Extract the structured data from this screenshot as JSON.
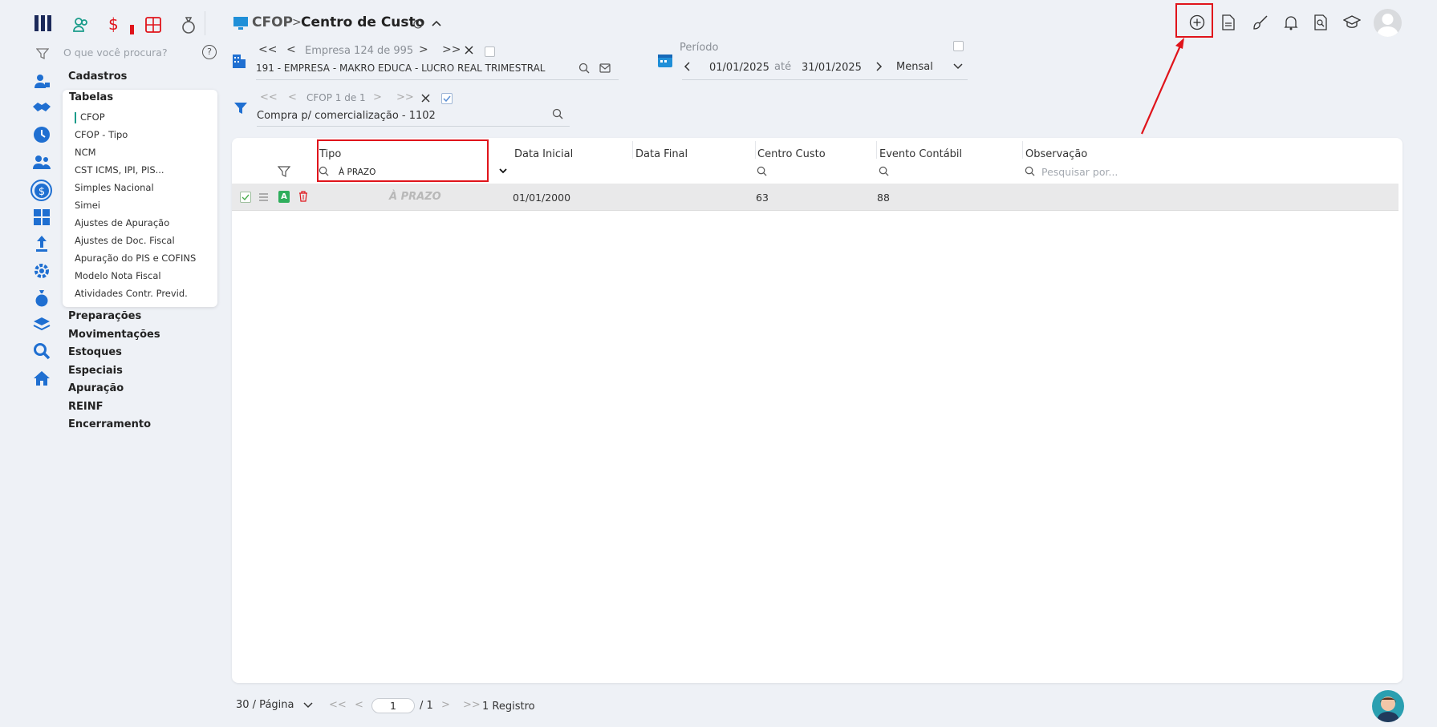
{
  "app": {
    "search_placeholder": "O que você procura?",
    "help_symbol": "?"
  },
  "menu": {
    "sections_top": [
      "Cadastros"
    ],
    "submenu_title": "Tabelas",
    "submenu_items": [
      "CFOP",
      "CFOP - Tipo",
      "NCM",
      "CST ICMS, IPI, PIS...",
      "Simples Nacional",
      "Simei",
      "Ajustes de Apuração",
      "Ajustes de Doc. Fiscal",
      "Apuração do PIS e COFINS",
      "Modelo Nota Fiscal",
      "Atividades Contr. Previd."
    ],
    "sections_bottom": [
      "Preparações",
      "Movimentações",
      "Estoques",
      "Especiais",
      "Apuração",
      "REINF",
      "Encerramento"
    ]
  },
  "header": {
    "crumb_parent": "CFOP",
    "crumb_separator": ">",
    "crumb_current": "Centro de Custo"
  },
  "empresa": {
    "nav_label": "Empresa 124 de 995",
    "value": "191 - EMPRESA - MAKRO EDUCA - LUCRO REAL TRIMESTRAL"
  },
  "periodo": {
    "label": "Período",
    "start": "01/01/2025",
    "separator": "até",
    "end": "31/01/2025",
    "mode": "Mensal"
  },
  "cfop_filter": {
    "nav_label": "CFOP 1 de 1",
    "value": "Compra p/ comercialização - 1102"
  },
  "grid": {
    "columns": [
      "Tipo",
      "Data Inicial",
      "Data Final",
      "Centro Custo",
      "Evento Contábil",
      "Observação"
    ],
    "tipo_filter_value": "À PRAZO",
    "obs_placeholder": "Pesquisar por...",
    "rows": [
      {
        "badge": "A",
        "tipo": "À PRAZO",
        "data_inicial": "01/01/2000",
        "data_final": "",
        "centro_custo": "63",
        "evento_contabil": "88",
        "observacao": ""
      }
    ]
  },
  "footer": {
    "page_size": "30 / Página",
    "page_current": "1",
    "page_total": "/ 1",
    "records": "1 Registro"
  },
  "colors": {
    "accent": "#1a9c8a",
    "highlight": "#e0141b",
    "brand_blue": "#1f6fd1"
  }
}
